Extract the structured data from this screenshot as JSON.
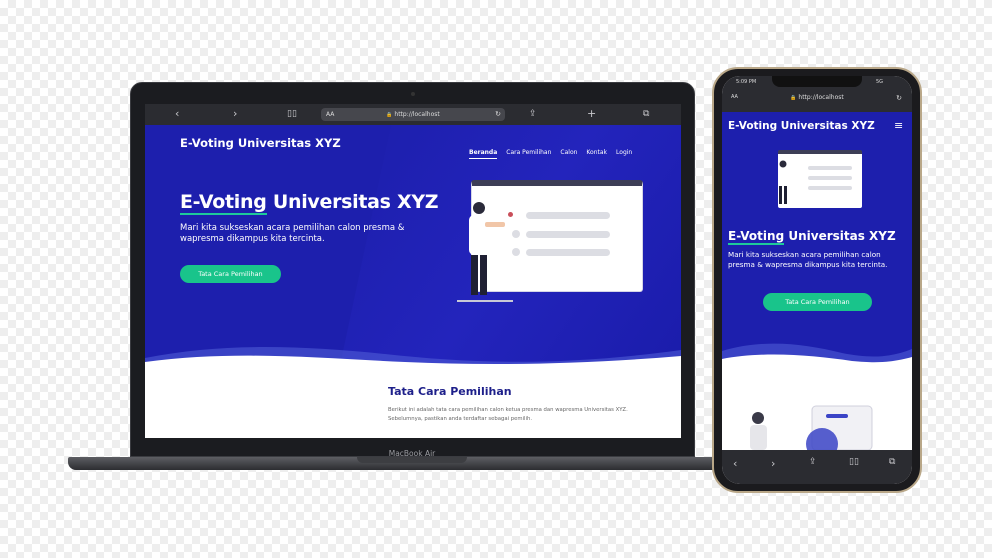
{
  "laptop": {
    "browser": {
      "url": "http://localhost",
      "text_size_label": "AA"
    },
    "brand": "E-Voting Universitas XYZ",
    "nav": [
      "Beranda",
      "Cara Pemilihan",
      "Calon",
      "Kontak",
      "Login"
    ],
    "hero": {
      "title_highlight": "E-Voting",
      "title_rest": " Universitas XYZ",
      "subtitle": "Mari kita sukseskan acara pemilihan calon presma & wapresma dikampus kita tercinta.",
      "button": "Tata Cara Pemilihan"
    },
    "section": {
      "heading": "Tata Cara Pemilihan",
      "text": "Berikut ini adalah tata cara pemilihan calon ketua presma dan wapresma Universitas XYZ. Sebelumnya, pastikan anda terdaftar sebagai pemilih."
    },
    "device_label": "MacBook Air"
  },
  "phone": {
    "time": "5:09 PM",
    "status": "5G",
    "browser": {
      "url": "http://localhost",
      "text_size_label": "AA"
    },
    "brand": "E-Voting Universitas XYZ",
    "hero": {
      "title_highlight": "E-Voting",
      "title_rest": " Universitas XYZ",
      "subtitle": "Mari kita sukseskan acara pemilihan calon presma & wapresma dikampus kita tercinta.",
      "button": "Tata Cara Pemilihan"
    }
  },
  "colors": {
    "hero_bg": "#1d1fad",
    "accent": "#19c48b",
    "heading": "#1d1f8a"
  }
}
